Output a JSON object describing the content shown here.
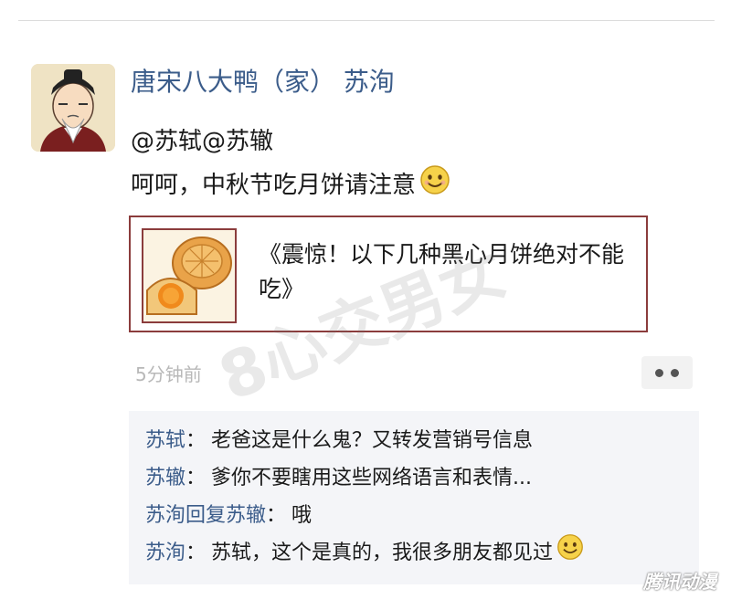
{
  "post": {
    "author": "唐宋八大鸭（家） 苏洵",
    "mentions": "@苏轼@苏辙",
    "text": "呵呵，中秋节吃月饼请注意",
    "link": {
      "title": "《震惊！以下几种黑心月饼绝对不能吃》"
    },
    "timestamp": "5分钟前"
  },
  "comments": [
    {
      "name": "苏轼",
      "sep": "：",
      "text": "老爸这是什么鬼？又转发营销号信息",
      "emoji": false
    },
    {
      "name": "苏辙",
      "sep": "：",
      "text": "爹你不要瞎用这些网络语言和表情...",
      "emoji": false
    },
    {
      "name": "苏洵回复苏辙",
      "sep": "：",
      "text": "哦",
      "emoji": false
    },
    {
      "name": "苏洵",
      "sep": "：",
      "text": "苏轼，这个是真的，我很多朋友都见过",
      "emoji": true
    }
  ],
  "watermark": "8心交男女",
  "source_mark": "腾讯动漫",
  "colors": {
    "link_name": "#3b5c8a",
    "card_border": "#8b3c3c",
    "comment_bg": "#f4f5f8"
  },
  "icons": [
    "smiley-emoji-icon",
    "more-dots-icon"
  ]
}
